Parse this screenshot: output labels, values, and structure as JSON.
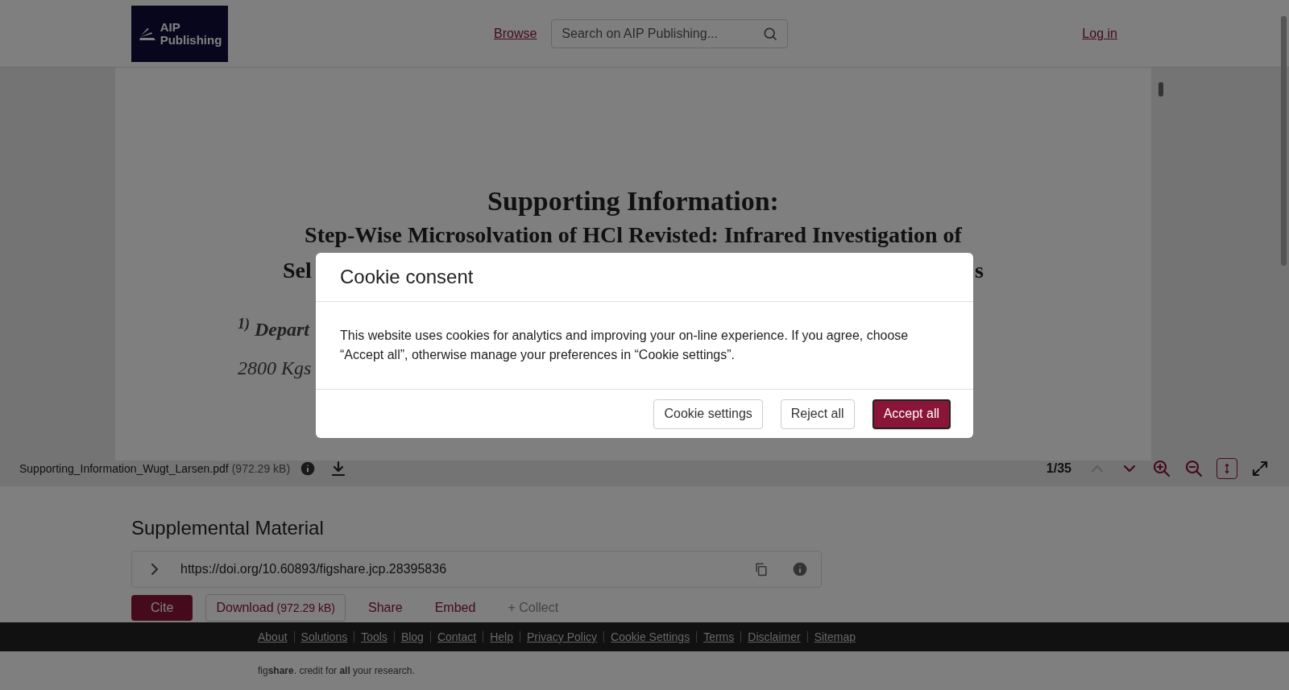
{
  "header": {
    "logo": [
      "AIP",
      "Publishing"
    ],
    "nav_link": "Browse",
    "search": {
      "placeholder": "Search on AIP Publishing..."
    },
    "login": "Log in"
  },
  "viewer": {
    "document": {
      "title": "Supporting Information:",
      "subtitle": "Step-Wise Microsolvation of HCl Revisted: Infrared Investigation of",
      "line_3_start": "Sel",
      "line_3_end": "s",
      "affiliation": "$^{1)}$ Depart",
      "address": "2800 Kgs"
    },
    "toolbar": {
      "file_name": "Supporting_Information_Wugt_Larsen.pdf",
      "file_size": "(972.29 kB)",
      "page": "1/35",
      "previous_disabled": true,
      "fit_selected": true
    }
  },
  "supplemental": {
    "heading": "Supplemental Material",
    "doi": "https://doi.org/10.60893/figshare.jcp.28395836",
    "actions": [
      {
        "kind": "primary",
        "label": "Cite"
      },
      {
        "kind": "outline",
        "label": "Download",
        "extra": "(972.29 kB)"
      },
      {
        "kind": "link",
        "label": "Share"
      },
      {
        "kind": "link",
        "label": "Embed"
      },
      {
        "kind": "muted",
        "label": "+ Collect"
      }
    ]
  },
  "footer": {
    "links": [
      "About",
      "Solutions",
      "Tools",
      "Blog",
      "Contact",
      "Help",
      "Privacy Policy",
      "Cookie Settings",
      "Terms",
      "Disclaimer",
      "Sitemap"
    ],
    "tagline": "fig**share**. credit for **all** your research."
  },
  "cookie_dialog": {
    "title": "Cookie consent",
    "message": "This website uses cookies for analytics and improving your on-line experience. If you agree, choose “Accept all”, otherwise manage your preferences in “Cookie settings”.",
    "buttons": [
      {
        "kind": "secondary",
        "label": "Cookie settings"
      },
      {
        "kind": "secondary",
        "label": "Reject all"
      },
      {
        "kind": "primary",
        "label": "Accept all"
      }
    ]
  }
}
